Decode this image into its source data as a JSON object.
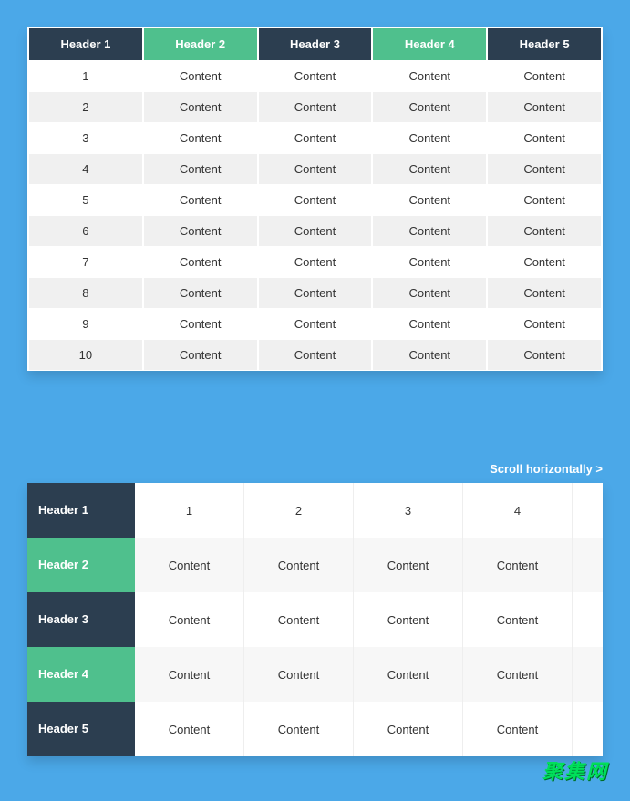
{
  "table1": {
    "headers": [
      "Header 1",
      "Header 2",
      "Header 3",
      "Header 4",
      "Header 5"
    ],
    "header_alt": [
      false,
      true,
      false,
      true,
      false
    ],
    "rows": [
      [
        "1",
        "Content",
        "Content",
        "Content",
        "Content"
      ],
      [
        "2",
        "Content",
        "Content",
        "Content",
        "Content"
      ],
      [
        "3",
        "Content",
        "Content",
        "Content",
        "Content"
      ],
      [
        "4",
        "Content",
        "Content",
        "Content",
        "Content"
      ],
      [
        "5",
        "Content",
        "Content",
        "Content",
        "Content"
      ],
      [
        "6",
        "Content",
        "Content",
        "Content",
        "Content"
      ],
      [
        "7",
        "Content",
        "Content",
        "Content",
        "Content"
      ],
      [
        "8",
        "Content",
        "Content",
        "Content",
        "Content"
      ],
      [
        "9",
        "Content",
        "Content",
        "Content",
        "Content"
      ],
      [
        "10",
        "Content",
        "Content",
        "Content",
        "Content"
      ]
    ]
  },
  "scroll_hint": "Scroll horizontally >",
  "table2": {
    "fixed_headers": [
      "Header 1",
      "Header 2",
      "Header 3",
      "Header 4",
      "Header 5"
    ],
    "fixed_alt": [
      "dark",
      "alt",
      "dark",
      "alt",
      "dark"
    ],
    "data_rows": [
      [
        "1",
        "2",
        "3",
        "4"
      ],
      [
        "Content",
        "Content",
        "Content",
        "Content"
      ],
      [
        "Content",
        "Content",
        "Content",
        "Content"
      ],
      [
        "Content",
        "Content",
        "Content",
        "Content"
      ],
      [
        "Content",
        "Content",
        "Content",
        "Content"
      ]
    ]
  },
  "watermark": "聚集网"
}
